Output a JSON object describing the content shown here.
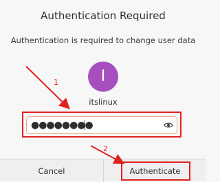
{
  "dialog": {
    "title": "Authentication Required",
    "message": "Authentication is required to change user data",
    "avatar_initial": "I",
    "username": "itslinux",
    "password": {
      "masked_value": "●●●●●●●●",
      "icon": "eye-icon"
    },
    "buttons": {
      "cancel_label": "Cancel",
      "authenticate_label": "Authenticate"
    }
  },
  "annotations": {
    "marker_1": "1",
    "marker_2": "2",
    "color": "#e1211f"
  },
  "colors": {
    "avatar": "#a74fbf",
    "background": "#f7f7f7"
  }
}
